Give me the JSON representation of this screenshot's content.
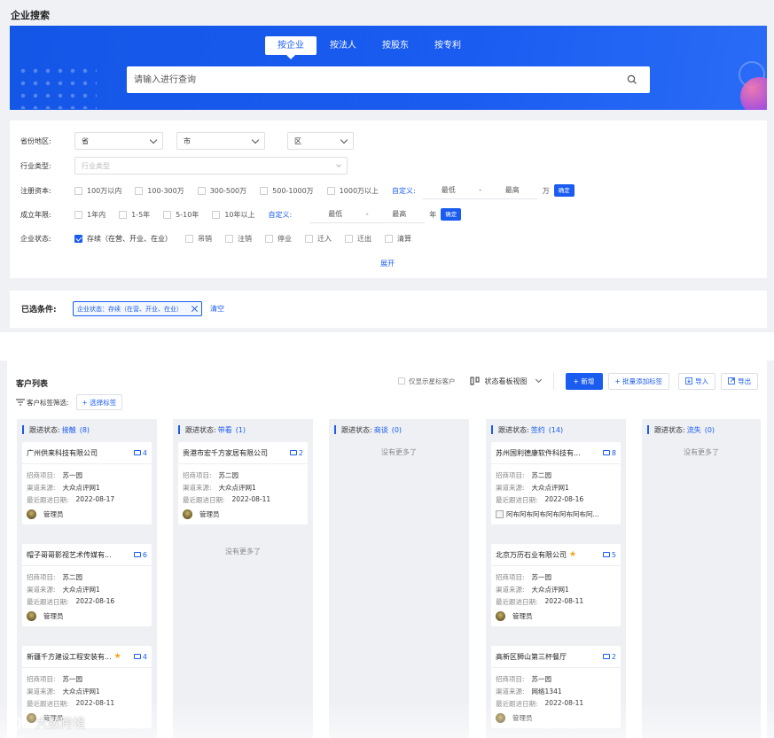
{
  "page": {
    "title": "企业搜索"
  },
  "search": {
    "tabs": [
      "按企业",
      "按法人",
      "按股东",
      "按专利"
    ],
    "active_tab": 0,
    "placeholder": "请输入进行查询"
  },
  "filters": {
    "region": {
      "label": "省份地区:",
      "province": "省",
      "city": "市",
      "district": "区"
    },
    "industry": {
      "label": "行业类型:",
      "placeholder": "行业类型"
    },
    "capital": {
      "label": "注册资本:",
      "options": [
        "100万以内",
        "100-300万",
        "300-500万",
        "500-1000万",
        "1000万以上"
      ],
      "custom": "自定义:",
      "min": "最低",
      "sep": "-",
      "max": "最高",
      "unit": "万",
      "ok": "确定"
    },
    "years": {
      "label": "成立年限:",
      "options": [
        "1年内",
        "1-5年",
        "5-10年",
        "10年以上"
      ],
      "custom": "自定义:",
      "min": "最低",
      "sep": "-",
      "max": "最高",
      "unit": "年",
      "ok": "确定"
    },
    "status": {
      "label": "企业状态:",
      "options": [
        "存续（在营、开业、在业）",
        "吊销",
        "注销",
        "停业",
        "迁入",
        "迁出",
        "清算"
      ],
      "checked": [
        0
      ]
    },
    "expand": "展开"
  },
  "selected": {
    "label": "已选条件:",
    "tags": [
      "企业状态：存续（在营、开业、在业）"
    ],
    "clear": "清空"
  },
  "list": {
    "title": "客户列表",
    "only_starred": "仅显示星标客户",
    "view": "状态看板视图",
    "buttons": {
      "add": "+ 新增",
      "batch_tag": "+ 批量添加标签",
      "import": "导入",
      "export": "导出"
    },
    "tag_filter": "客户标签筛选:",
    "choose_tag": "+ 选择标签"
  },
  "board": {
    "status_prefix": "跟进状态:",
    "no_more": "没有更多了",
    "field_labels": {
      "project": "招商项目:",
      "channel": "渠道来源:",
      "last_follow": "最近跟进日期:"
    },
    "columns": [
      {
        "status": "接触",
        "count": "(8)",
        "cards": [
          {
            "name": "广州供来科技有限公司",
            "starred": false,
            "count": "4",
            "project": "苏一园",
            "channel": "大众点评网1",
            "date": "2022-08-17",
            "owner": "管理员"
          },
          {
            "name": "帽子哥哥影视艺术传媒有...",
            "starred": false,
            "count": "6",
            "project": "苏二园",
            "channel": "大众点评网1",
            "date": "2022-08-16",
            "owner": "管理员"
          },
          {
            "name": "新疆千方建设工程安装有...",
            "starred": true,
            "count": "4",
            "project": "苏一园",
            "channel": "大众点评网1",
            "date": "2022-08-11",
            "owner": "管理员"
          }
        ]
      },
      {
        "status": "带看",
        "count": "(1)",
        "cards": [
          {
            "name": "贵港市宏千方家居有限公司",
            "starred": false,
            "count": "2",
            "project": "苏二园",
            "channel": "大众点评网1",
            "date": "2022-08-11",
            "owner": "管理员"
          }
        ]
      },
      {
        "status": "商谈",
        "count": "(0)",
        "cards": []
      },
      {
        "status": "签约",
        "count": "(14)",
        "cards": [
          {
            "name": "苏州国利德康软件科技有...",
            "starred": false,
            "count": "8",
            "project": "苏二园",
            "channel": "大众点评网1",
            "date": "2022-08-16",
            "owner": "阿布阿布阿布阿布阿布阿布阿..."
          },
          {
            "name": "北京万历石业有限公司",
            "starred": true,
            "count": "5",
            "project": "苏一园",
            "channel": "大众点评网1",
            "date": "2022-08-11",
            "owner": "管理员"
          },
          {
            "name": "高新区狮山第三杯餐厅",
            "starred": false,
            "count": "2",
            "project": "苏一园",
            "channel": "网络1341",
            "date": "2022-08-11",
            "owner": "管理员"
          }
        ]
      },
      {
        "status": "流失",
        "count": "(0)",
        "cards": []
      }
    ]
  },
  "watermark": "大数跨境",
  "colors": {
    "primary": "#1a5cf0",
    "banner": "#1456e6",
    "star": "#f7a11a"
  }
}
